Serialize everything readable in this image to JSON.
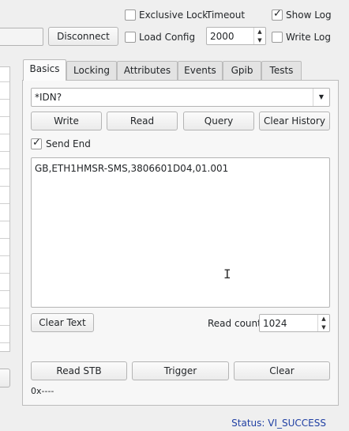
{
  "top": {
    "exclusive_lock_label": "Exclusive Lock",
    "timeout_label": "Timeout",
    "show_log_label": "Show Log",
    "disconnect_label": "Disconnect",
    "load_config_label": "Load Config",
    "timeout_value": "2000",
    "write_log_label": "Write Log",
    "show_log_checked": true,
    "exclusive_lock_checked": false,
    "load_config_checked": false,
    "write_log_checked": false
  },
  "tabs": [
    {
      "label": "Basics"
    },
    {
      "label": "Locking"
    },
    {
      "label": "Attributes"
    },
    {
      "label": "Events"
    },
    {
      "label": "Gpib"
    },
    {
      "label": "Tests"
    }
  ],
  "basics": {
    "command_value": "*IDN?",
    "write_label": "Write",
    "read_label": "Read",
    "query_label": "Query",
    "clear_history_label": "Clear History",
    "send_end_label": "Send End",
    "send_end_checked": true,
    "response_text": "GB,ETH1HMSR-SMS,3806601D04,01.001",
    "clear_text_label": "Clear Text",
    "read_count_label": "Read count",
    "read_count_value": "1024",
    "read_stb_label": "Read STB",
    "trigger_label": "Trigger",
    "clear_label": "Clear",
    "stb_value": "0x----"
  },
  "status": {
    "text": "Status: VI_SUCCESS",
    "color": "#1f3fa3"
  },
  "icons": {
    "checkmark": "check-icon",
    "dropdown": "chevron-down-icon",
    "spin_up": "spin-up-icon",
    "spin_down": "spin-down-icon",
    "cursor": "text-cursor-icon"
  }
}
